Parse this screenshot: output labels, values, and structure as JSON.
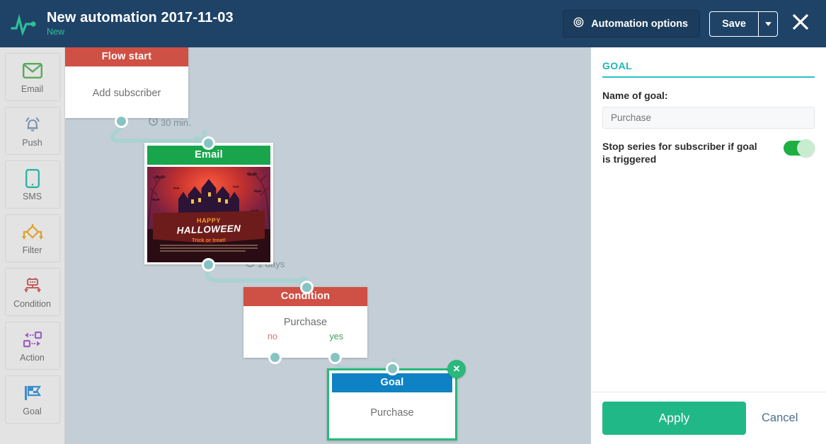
{
  "header": {
    "logo_icon": "pulse-logo-icon",
    "title": "New automation 2017-11-03",
    "status": "New",
    "automation_options_label": "Automation options",
    "automation_options_icon": "gear-icon",
    "save_label": "Save",
    "save_caret_icon": "chevron-down-icon",
    "close_icon": "close-icon",
    "bg_color": "#1f4367",
    "accent_color": "#2fbf9a"
  },
  "sidebar": {
    "items": [
      {
        "label": "Email",
        "icon": "envelope-icon",
        "color": "#5aa95a"
      },
      {
        "label": "Push",
        "icon": "bell-icon",
        "color": "#7d91ab"
      },
      {
        "label": "SMS",
        "icon": "phone-icon",
        "color": "#2bb3a3"
      },
      {
        "label": "Filter",
        "icon": "filter-icon",
        "color": "#e0a028"
      },
      {
        "label": "Condition",
        "icon": "robot-icon",
        "color": "#bf5f5f"
      },
      {
        "label": "Action",
        "icon": "action-icon",
        "color": "#9b5fc4"
      },
      {
        "label": "Goal",
        "icon": "flag-icon",
        "color": "#3d8ec9"
      }
    ]
  },
  "canvas": {
    "bg_color": "#c3ced6",
    "nodes": [
      {
        "id": "flow-start",
        "header": "Flow start",
        "header_color": "#cf5044",
        "body": "Add subscriber"
      },
      {
        "id": "email",
        "header": "Email",
        "header_color": "#18a54c",
        "thumbnail": {
          "title_small": "HAPPY",
          "title_big": "HALLOWEEN",
          "subtitle": "Trick or treat!"
        }
      },
      {
        "id": "condition",
        "header": "Condition",
        "header_color": "#cf5044",
        "body": "Purchase",
        "port_no": "no",
        "port_yes": "yes",
        "port_no_color": "#d9736f",
        "port_yes_color": "#3f9d5f"
      },
      {
        "id": "goal",
        "header": "Goal",
        "header_color": "#0e82c4",
        "body": "Purchase",
        "selected": true,
        "selection_color": "#2ab87c",
        "delete_icon": "close-icon"
      }
    ],
    "edges": [
      {
        "label": "30 min.",
        "icon": "clock-icon"
      },
      {
        "label": "1 days",
        "icon": "clock-icon"
      }
    ]
  },
  "panel": {
    "title": "GOAL",
    "title_color": "#1fb5b5",
    "name_label": "Name of goal:",
    "name_value": "Purchase",
    "name_placeholder": "Purchase",
    "toggle_label": "Stop series for subscriber if goal is triggered",
    "toggle_on": true,
    "apply_label": "Apply",
    "cancel_label": "Cancel",
    "apply_color": "#21b887"
  }
}
